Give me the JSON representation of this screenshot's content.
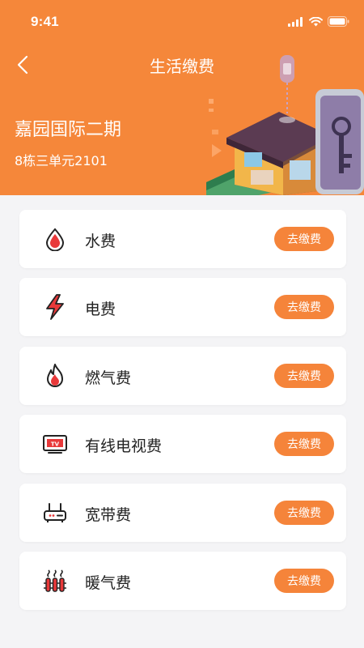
{
  "status": {
    "time": "9:41"
  },
  "header": {
    "title": "生活缴费",
    "community": "嘉园国际二期",
    "unit": "8栋三单元2101"
  },
  "bills": [
    {
      "label": "水费",
      "icon": "water-drop-icon",
      "action": "去缴费"
    },
    {
      "label": "电费",
      "icon": "lightning-icon",
      "action": "去缴费"
    },
    {
      "label": "燃气费",
      "icon": "flame-icon",
      "action": "去缴费"
    },
    {
      "label": "有线电视费",
      "icon": "tv-icon",
      "action": "去缴费"
    },
    {
      "label": "宽带费",
      "icon": "router-icon",
      "action": "去缴费"
    },
    {
      "label": "暖气费",
      "icon": "radiator-icon",
      "action": "去缴费"
    }
  ],
  "colors": {
    "accent": "#f5873a",
    "icon_red": "#e8393a",
    "background": "#f4f4f6"
  }
}
